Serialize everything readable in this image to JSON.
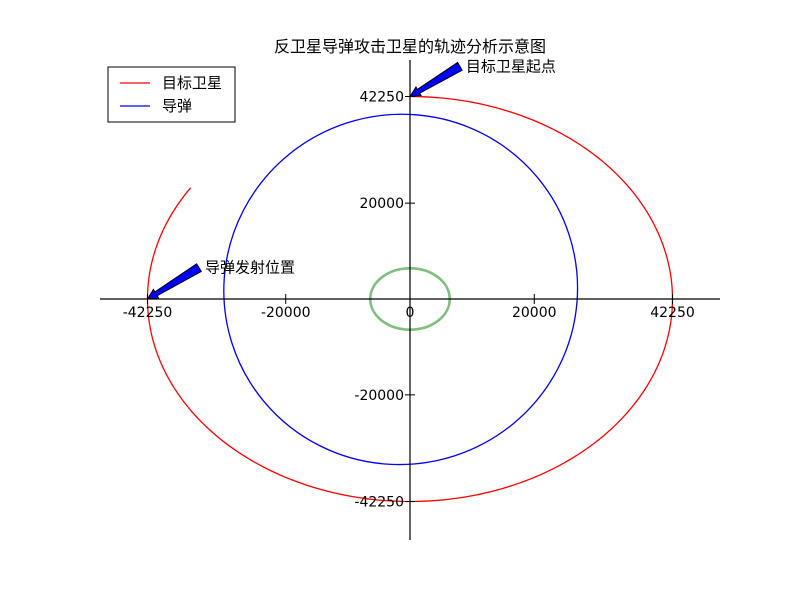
{
  "chart_data": {
    "type": "line",
    "title": "反卫星导弹攻击卫星的轨迹分析示意图",
    "xlabel": "",
    "ylabel": "",
    "xlim": [
      -50000,
      50000
    ],
    "ylim": [
      -50000,
      50000
    ],
    "x_ticks": [
      -42250,
      -20000,
      0,
      20000,
      42250
    ],
    "x_tick_labels": [
      "-42250",
      "-20000",
      "0",
      "20000",
      "42250"
    ],
    "y_ticks": [
      42250,
      20000,
      -20000,
      -42250
    ],
    "y_tick_labels": [
      "42250",
      "20000",
      "-20000",
      "-42250"
    ],
    "grid": false,
    "legend_position": "top-left",
    "series": [
      {
        "name": "目标卫星",
        "color": "#ff0000",
        "kind": "ellipse-arc",
        "center": [
          0,
          0
        ],
        "semi_axis_x": 42250,
        "semi_axis_y": 42250,
        "start_point": [
          0,
          42250
        ],
        "end_point": [
          -35000,
          23000
        ]
      },
      {
        "name": "导弹",
        "color": "#0000ff",
        "kind": "ellipse",
        "center": [
          -1500,
          2000
        ],
        "semi_axis_x": 28500,
        "semi_axis_y": 36500,
        "tilt_deg": -18
      },
      {
        "name": "",
        "color": "#7fbf7f",
        "kind": "ellipse",
        "center": [
          0,
          0
        ],
        "semi_axis_x": 6400,
        "semi_axis_y": 6400
      }
    ],
    "annotations": [
      {
        "text": "目标卫星起点",
        "point": [
          0,
          42250
        ],
        "text_pos": [
          9000,
          47500
        ]
      },
      {
        "text": "导弹发射位置",
        "point": [
          -42250,
          0
        ],
        "text_pos": [
          -33000,
          5500
        ]
      }
    ]
  }
}
